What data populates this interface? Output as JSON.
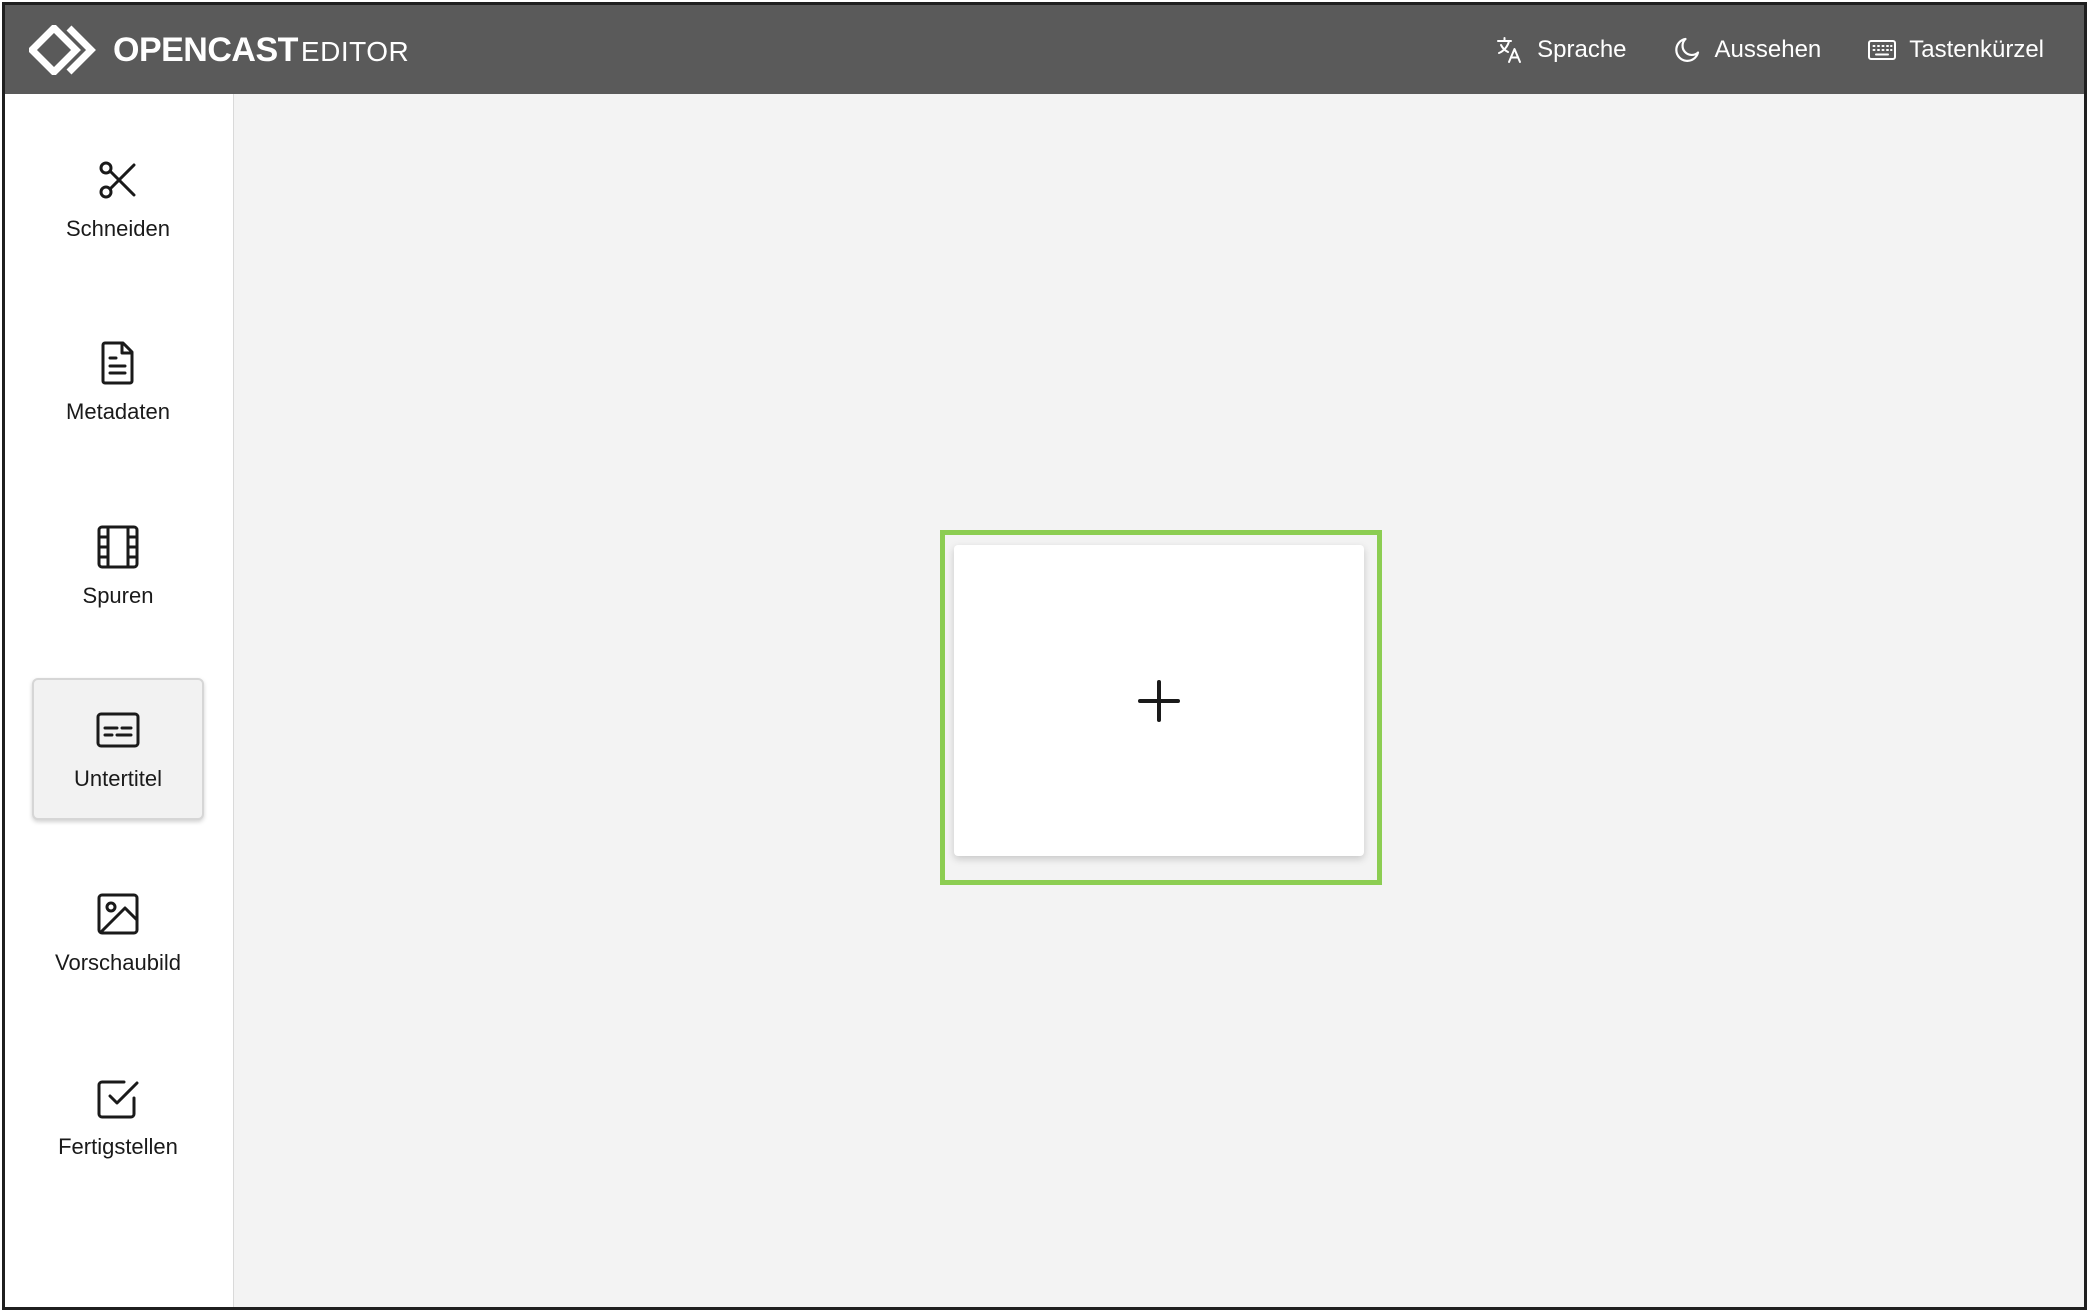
{
  "header": {
    "logo_main": "OPENCAST",
    "logo_sub": "EDITOR",
    "buttons": [
      {
        "label": "Sprache",
        "icon": "translate-icon"
      },
      {
        "label": "Aussehen",
        "icon": "moon-icon"
      },
      {
        "label": "Tastenkürzel",
        "icon": "keyboard-icon"
      }
    ]
  },
  "sidebar": {
    "items": [
      {
        "label": "Schneiden",
        "icon": "scissors-icon"
      },
      {
        "label": "Metadaten",
        "icon": "document-icon"
      },
      {
        "label": "Spuren",
        "icon": "film-icon"
      },
      {
        "label": "Untertitel",
        "icon": "subtitles-icon",
        "active": true
      },
      {
        "label": "Vorschaubild",
        "icon": "image-icon"
      },
      {
        "label": "Fertigstellen",
        "icon": "check-square-icon"
      }
    ]
  },
  "main": {
    "add_card_icon": "plus-icon",
    "highlight_color": "#8ccd52"
  },
  "colors": {
    "header_bg": "#5a5a5a",
    "main_bg": "#f3f3f3",
    "active_nav_bg": "#f2f2f2"
  }
}
